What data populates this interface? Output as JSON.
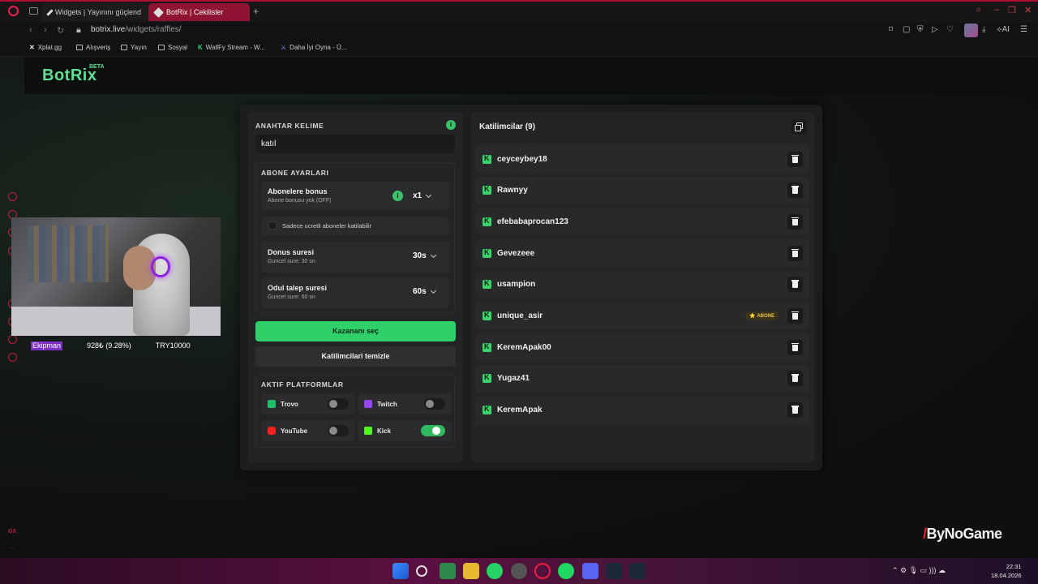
{
  "browser": {
    "tabs": [
      {
        "label": "Widgets | Yayınını güçlend",
        "active": false
      },
      {
        "label": "BotRix | Cekilisler",
        "active": true
      }
    ],
    "url_host": "botrix.live",
    "url_path": "/widgets/raffles/",
    "bookmarks": [
      "Xplat.gg",
      "Alışveriş",
      "Yayın",
      "Sosyal",
      "WallFy Stream - W...",
      "Daha İyi Oyna - Ü..."
    ],
    "accent": "#b01030"
  },
  "brand": {
    "name": "BotRix",
    "badge": "BETA",
    "color": "#5fe090"
  },
  "webcam": {
    "label": "Ekipman",
    "stat": "928₺ (9.28%)",
    "goal": "TRY10000"
  },
  "keyword": {
    "title": "ANAHTAR KELIME",
    "value": "katıl"
  },
  "subscriber": {
    "title": "ABONE AYARLARI",
    "bonus_title": "Abonelere bonus",
    "bonus_sub": "Abone bonusu yok (OFF)",
    "bonus_value": "x1",
    "paid_only": "Sadece ucretli aboneler katilabilir",
    "duration_title": "Donus suresi",
    "duration_sub": "Guncel sure: 30 sn",
    "duration_value": "30s",
    "claim_title": "Odul talep suresi",
    "claim_sub": "Guncel sure: 60 sn",
    "claim_value": "60s"
  },
  "buttons": {
    "pick_winner": "Kazananı seç",
    "clear": "Katilimcilari temizle"
  },
  "platforms": {
    "title": "AKTIF PLATFORMLAR",
    "items": [
      {
        "name": "Trovo",
        "enabled": false,
        "color": "#1fbe6a"
      },
      {
        "name": "Twitch",
        "enabled": false,
        "color": "#9146ff"
      },
      {
        "name": "YouTube",
        "enabled": false,
        "color": "#ff2020"
      },
      {
        "name": "Kick",
        "enabled": true,
        "color": "#53fc18"
      }
    ]
  },
  "participants": {
    "title": "Katilimcilar (9)",
    "list": [
      {
        "name": "ceyceybey18",
        "badge": ""
      },
      {
        "name": "Rawnyy",
        "badge": ""
      },
      {
        "name": "efebabaprocan123",
        "badge": ""
      },
      {
        "name": "Gevezeee",
        "badge": ""
      },
      {
        "name": "usampion",
        "badge": ""
      },
      {
        "name": "unique_asir",
        "badge": "⭐ ABONE"
      },
      {
        "name": "KeremApak00",
        "badge": ""
      },
      {
        "name": "Yugaz41",
        "badge": ""
      },
      {
        "name": "KeremApak",
        "badge": ""
      }
    ]
  },
  "watermark": {
    "text": "ByNoGame",
    "mark": "/"
  },
  "taskbar": {
    "time": "22:31",
    "date": "18.04.2026"
  }
}
